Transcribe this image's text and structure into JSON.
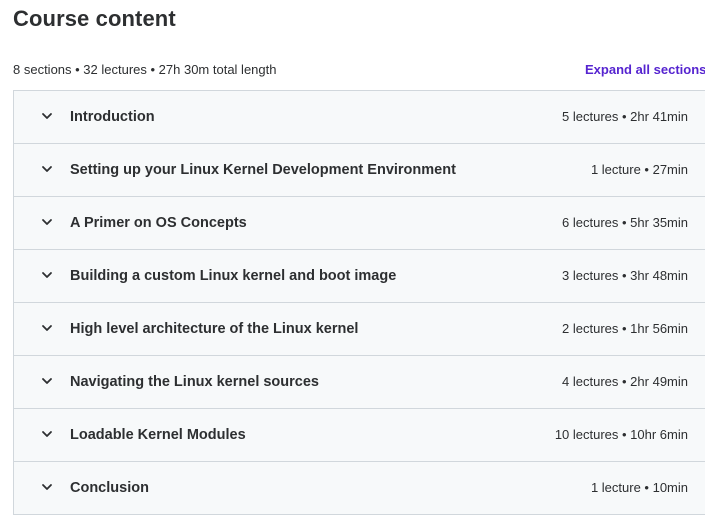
{
  "header": {
    "title": "Course content",
    "summary": "8 sections • 32 lectures • 27h 30m total length",
    "expand_all_label": "Expand all sections"
  },
  "sections": [
    {
      "title": "Introduction",
      "meta": "5 lectures • 2hr 41min"
    },
    {
      "title": "Setting up your Linux Kernel Development Environment",
      "meta": "1 lecture • 27min"
    },
    {
      "title": "A Primer on OS Concepts",
      "meta": "6 lectures • 5hr 35min"
    },
    {
      "title": "Building a custom Linux kernel and boot image",
      "meta": "3 lectures • 3hr 48min"
    },
    {
      "title": "High level architecture of the Linux kernel",
      "meta": "2 lectures • 1hr 56min"
    },
    {
      "title": "Navigating the Linux kernel sources",
      "meta": "4 lectures • 2hr 49min"
    },
    {
      "title": "Loadable Kernel Modules",
      "meta": "10 lectures • 10hr 6min"
    },
    {
      "title": "Conclusion",
      "meta": "1 lecture • 10min"
    }
  ],
  "icons": {
    "section_toggle": "chevron-down-icon"
  },
  "colors": {
    "accent": "#5624d0",
    "text": "#2d2f31",
    "section_bg": "#f7f9fa",
    "border": "#d1d7dc"
  }
}
